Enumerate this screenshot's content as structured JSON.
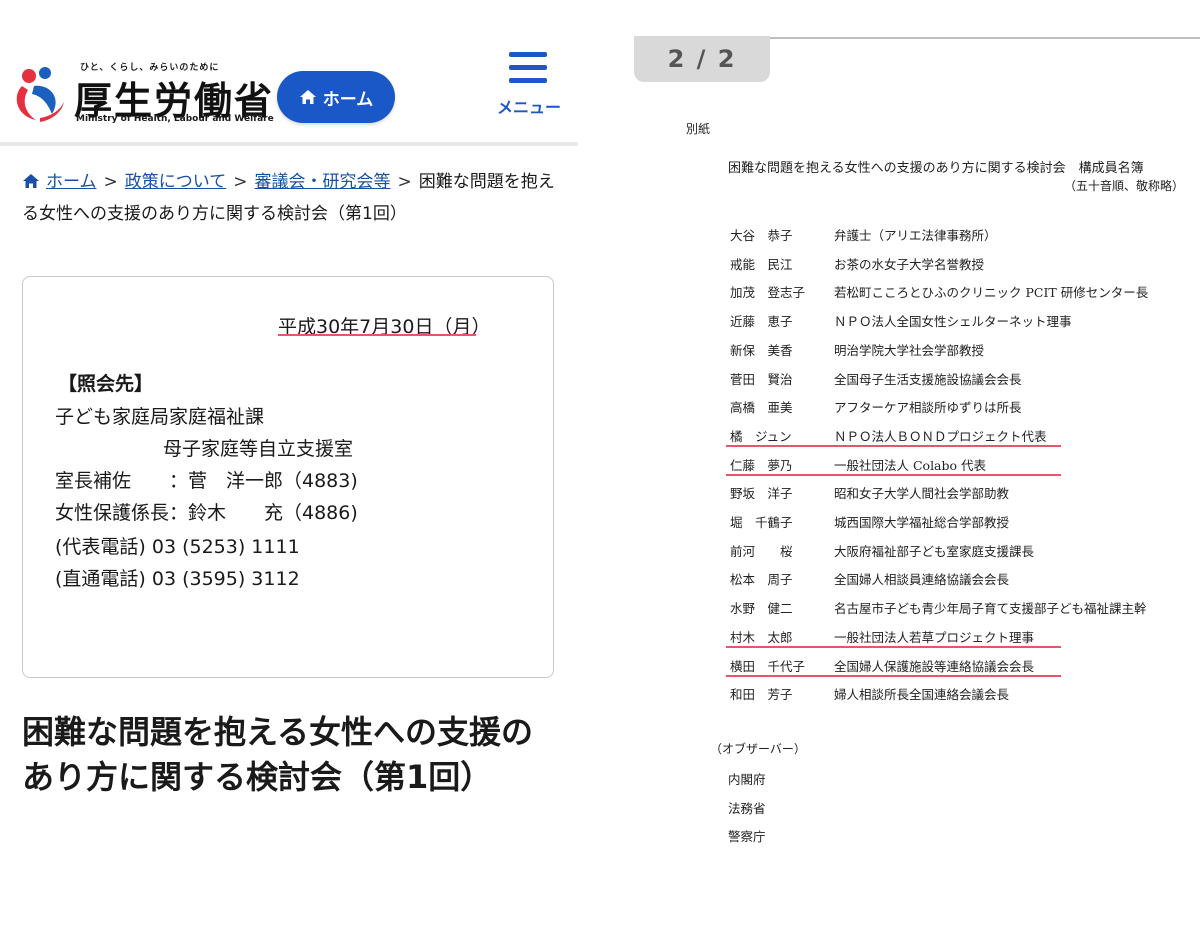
{
  "header": {
    "tagline": "ひと、くらし、みらいのために",
    "ministry_name": "厚生労働省",
    "ministry_name_en": "Ministry of Health, Labour and Welfare",
    "home_button": "ホーム",
    "menu_label": "メニュー",
    "brand_blue": "#1a57c7"
  },
  "breadcrumb": {
    "items": [
      "ホーム",
      "政策について",
      "審議会・研究会等"
    ],
    "current": "困難な問題を抱える女性への支援のあり方に関する検討会（第1回）",
    "separator": ">"
  },
  "contact": {
    "date": "平成30年7月30日（月）",
    "heading": "【照会先】",
    "lines": [
      "子ども家庭局家庭福祉課",
      "母子家庭等自立支援室",
      "室長補佐　　：菅　洋一郎（4883)",
      "女性保護係長：鈴木　　充（4886)",
      "(代表電話) 03 (5253) 1111",
      "(直通電話) 03 (3595) 3112"
    ]
  },
  "page_title": "困難な問題を抱える女性への支援のあり方に関する検討会（第1回）",
  "document": {
    "page_indicator": "2 / 2",
    "attachment_label": "別紙",
    "title": "困難な問題を抱える女性への支援のあり方に関する検討会　構成員名簿",
    "note": "（五十音順、敬称略）",
    "highlight_color": "#e7556a",
    "members": [
      {
        "name": "大谷　恭子",
        "title": "弁護士（アリエ法律事務所）",
        "underlined": false
      },
      {
        "name": "戒能　民江",
        "title": "お茶の水女子大学名誉教授",
        "underlined": false
      },
      {
        "name": "加茂　登志子",
        "title": "若松町こころとひふのクリニック PCIT 研修センター長",
        "underlined": false
      },
      {
        "name": "近藤　恵子",
        "title": "ＮＰＯ法人全国女性シェルターネット理事",
        "underlined": false
      },
      {
        "name": "新保　美香",
        "title": "明治学院大学社会学部教授",
        "underlined": false
      },
      {
        "name": "菅田　賢治",
        "title": "全国母子生活支援施設協議会会長",
        "underlined": false
      },
      {
        "name": "高橋　亜美",
        "title": "アフターケア相談所ゆずりは所長",
        "underlined": false
      },
      {
        "name": "橘　ジュン",
        "title": "ＮＰＯ法人ＢＯＮＤプロジェクト代表",
        "underlined": true
      },
      {
        "name": "仁藤　夢乃",
        "title": "一般社団法人 Colabo 代表",
        "underlined": true
      },
      {
        "name": "野坂　洋子",
        "title": "昭和女子大学人間社会学部助教",
        "underlined": false
      },
      {
        "name": "堀　千鶴子",
        "title": "城西国際大学福祉総合学部教授",
        "underlined": false
      },
      {
        "name": "前河　　桜",
        "title": "大阪府福祉部子ども室家庭支援課長",
        "underlined": false
      },
      {
        "name": "松本　周子",
        "title": "全国婦人相談員連絡協議会会長",
        "underlined": false
      },
      {
        "name": "水野　健二",
        "title": "名古屋市子ども青少年局子育て支援部子ども福祉課主幹",
        "underlined": false
      },
      {
        "name": "村木　太郎",
        "title": "一般社団法人若草プロジェクト理事",
        "underlined": true
      },
      {
        "name": "横田　千代子",
        "title": "全国婦人保護施設等連絡協議会会長",
        "underlined": true
      },
      {
        "name": "和田　芳子",
        "title": "婦人相談所長全国連絡会議会長",
        "underlined": false
      }
    ],
    "observers_heading": "（オブザーバー）",
    "observers": [
      "内閣府",
      "法務省",
      "警察庁"
    ]
  }
}
